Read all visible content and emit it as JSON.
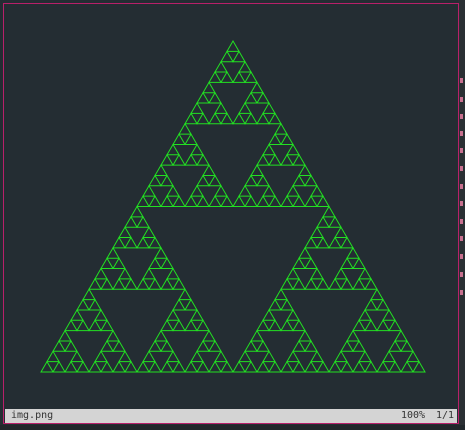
{
  "viewer": {
    "filename": "img.png",
    "zoom": "100%",
    "page": "1/1"
  },
  "image": {
    "subject": "sierpinski-triangle",
    "recursion_depth": 5,
    "line_color": "#22e022",
    "background_color": "#242d33"
  },
  "colors": {
    "frame_border": "#b8206a",
    "status_bar_bg": "#d4d4d4",
    "status_bar_text": "#333333"
  }
}
